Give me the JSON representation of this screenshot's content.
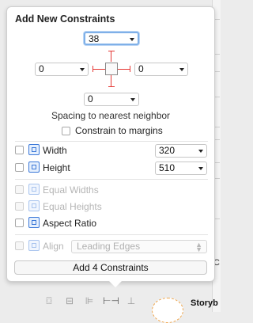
{
  "popover": {
    "title": "Add New Constraints",
    "top_value": "38",
    "left_value": "0",
    "right_value": "0",
    "bottom_value": "0",
    "spacing_caption": "Spacing to nearest neighbor",
    "constrain_margins_label": "Constrain to margins",
    "width": {
      "label": "Width",
      "value": "320"
    },
    "height": {
      "label": "Height",
      "value": "510"
    },
    "equal_widths_label": "Equal Widths",
    "equal_heights_label": "Equal Heights",
    "aspect_ratio_label": "Aspect Ratio",
    "align_label": "Align",
    "align_value": "Leading Edges",
    "add_button_label": "Add 4 Constraints"
  },
  "background": {
    "storyboard_label": "Storyb",
    "side_letter": "C"
  },
  "toolbar": {
    "icons": [
      "resolve-icon",
      "stack-icon",
      "align-icon",
      "pin-icon",
      "resolve-layout-icon"
    ]
  },
  "colors": {
    "accent": "#3b78d8",
    "spacer_red": "#e53935",
    "focus_ring": "#7fb0e8"
  }
}
